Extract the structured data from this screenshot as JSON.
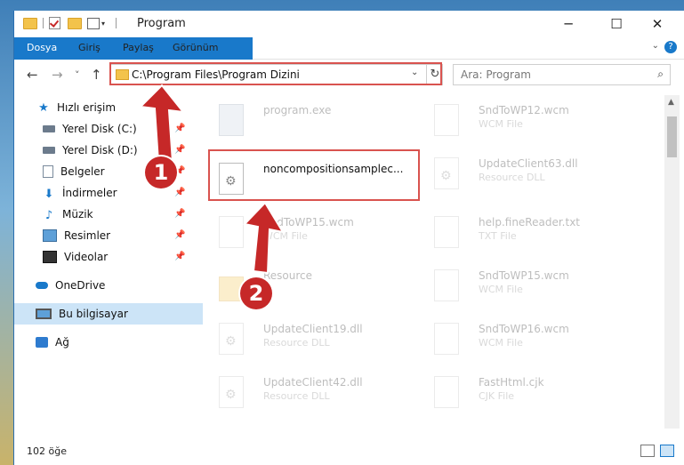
{
  "window": {
    "title": "Program"
  },
  "window_controls": {
    "minimize": "─",
    "maximize": "☐",
    "close": "✕"
  },
  "ribbon": {
    "tabs": [
      "Dosya",
      "Giriş",
      "Paylaş",
      "Görünüm"
    ],
    "help": "?"
  },
  "nav": {
    "back": "←",
    "forward": "→",
    "recent": "˅",
    "up": "↑"
  },
  "address": {
    "path": "C:\\Program Files\\Program Dizini",
    "dropdown": "⌄",
    "refresh": "↻"
  },
  "search": {
    "placeholder": "Ara: Program",
    "icon": "search-icon"
  },
  "sidebar": {
    "items": [
      {
        "label": "Hızlı erişim",
        "icon": "star-icon",
        "pinned": false
      },
      {
        "label": "Yerel Disk (C:)",
        "icon": "disk-icon",
        "pinned": true
      },
      {
        "label": "Yerel Disk (D:)",
        "icon": "disk-icon",
        "pinned": true
      },
      {
        "label": "Belgeler",
        "icon": "document-icon",
        "pinned": true
      },
      {
        "label": "İndirmeler",
        "icon": "download-icon",
        "pinned": true
      },
      {
        "label": "Müzik",
        "icon": "music-icon",
        "pinned": true
      },
      {
        "label": "Resimler",
        "icon": "pictures-icon",
        "pinned": true
      },
      {
        "label": "Videolar",
        "icon": "videos-icon",
        "pinned": true
      },
      {
        "label": "OneDrive",
        "icon": "cloud-icon",
        "pinned": false
      },
      {
        "label": "Bu bilgisayar",
        "icon": "pc-icon",
        "pinned": false,
        "selected": true
      },
      {
        "label": "Ağ",
        "icon": "network-icon",
        "pinned": false
      }
    ]
  },
  "files": [
    {
      "name": "program.exe",
      "type": "",
      "faded": true,
      "icon": "exe-icon"
    },
    {
      "name": "SndToWP12.wcm",
      "type": "WCM File",
      "faded": true,
      "icon": "file-icon"
    },
    {
      "name": "noncompositionsamplec...",
      "type": "",
      "faded": false,
      "icon": "gear-file-icon"
    },
    {
      "name": "UpdateClient63.dll",
      "type": "Resource DLL",
      "faded": true,
      "icon": "gear-file-icon"
    },
    {
      "name": "SndToWP15.wcm",
      "type": "WCM File",
      "faded": true,
      "icon": "file-icon"
    },
    {
      "name": "help.fineReader.txt",
      "type": "TXT File",
      "faded": true,
      "icon": "file-icon"
    },
    {
      "name": "Resource",
      "type": "",
      "faded": true,
      "icon": "folder-icon"
    },
    {
      "name": "SndToWP15.wcm",
      "type": "WCM File",
      "faded": true,
      "icon": "file-icon"
    },
    {
      "name": "UpdateClient19.dll",
      "type": "Resource DLL",
      "faded": true,
      "icon": "gear-file-icon"
    },
    {
      "name": "SndToWP16.wcm",
      "type": "WCM File",
      "faded": true,
      "icon": "file-icon"
    },
    {
      "name": "UpdateClient42.dll",
      "type": "Resource DLL",
      "faded": true,
      "icon": "gear-file-icon"
    },
    {
      "name": "FastHtml.cjk",
      "type": "CJK File",
      "faded": true,
      "icon": "file-icon"
    }
  ],
  "status": {
    "count": "102 öğe"
  },
  "annotations": {
    "step1": "1",
    "step2": "2",
    "color": "#c62828"
  }
}
